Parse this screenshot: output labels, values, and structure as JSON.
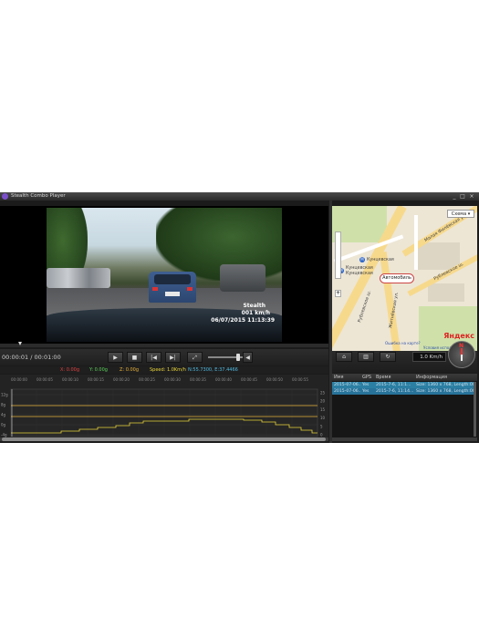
{
  "window": {
    "title": "Stealth Combo Player",
    "minimize": "_",
    "maximize": "□",
    "close": "×"
  },
  "osd": {
    "brand": "Stealth",
    "speed": "001  km/h",
    "datetime": "06/07/2015  11:13:39"
  },
  "playback": {
    "time": "00:00:01 / 00:01:00",
    "progress": 0.05,
    "volume": 0.85
  },
  "telemetry": {
    "x": "X: 0.00g",
    "y": "Y: 0.00g",
    "z": "Z: 0.00g",
    "speed": "Speed: 1.0Km/h",
    "coords": "N:55.7300, E:37.4466"
  },
  "graph": {
    "left_ticks": [
      "12g",
      "8g",
      "4g",
      "0g",
      "-4g"
    ],
    "right_ticks": [
      "25",
      "20",
      "15",
      "10",
      "5",
      "0"
    ],
    "time_ticks": [
      "00:00:00",
      "00:00:05",
      "00:00:10",
      "00:00:15",
      "00:00:20",
      "00:00:25",
      "00:00:30",
      "00:00:35",
      "00:00:40",
      "00:00:45",
      "00:00:50",
      "00:00:55"
    ]
  },
  "map": {
    "scheme_button": "Схема ▾",
    "labels": {
      "kuntsevskaya1": "Кунцевская",
      "kuntsevskaya2": "Кунцевская",
      "kuntsevskaya3": "Кунцевская",
      "rublevskoe": "Рублевское ш.",
      "rublevskoe2": "Рублевское ш.",
      "malaya_filevskaya": "Малая Филёвская ул.",
      "zhitnevskaya": "Житнёвская ул."
    },
    "callout": "Автомобиль",
    "logo": "Яндекс",
    "error_link": "Ошибка на карте?",
    "terms_link": "Условия использования"
  },
  "side_controls": {
    "speed": "1.0 Km/h",
    "compass_north": "N"
  },
  "files": {
    "columns": [
      "Имя",
      "GPS",
      "Время",
      "Информация"
    ],
    "rows": [
      {
        "name": "2015-07-06...",
        "gps": "Yes",
        "time": "2015-7-6, 11:1...",
        "info": "Size: 1360 x 768, Length:00:01:..."
      },
      {
        "name": "2015-07-06...",
        "gps": "Yes",
        "time": "2015-7-6, 11:14...",
        "info": "Size: 1360 x 768, Length:00:01:..."
      }
    ]
  },
  "colors": {
    "x_axis": "#e04040",
    "y_axis": "#5ad05a",
    "z_axis": "#e8b23a",
    "speed": "#e8d43a",
    "coords": "#4fb8e0"
  }
}
